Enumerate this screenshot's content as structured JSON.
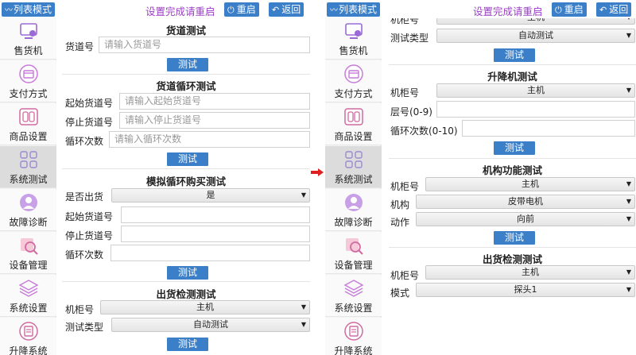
{
  "header": {
    "mode_label": "列表模式",
    "title": "设置完成请重启",
    "restart_label": "重启",
    "back_label": "返回"
  },
  "sidebar": {
    "items": [
      {
        "label": "售货机",
        "icon": "vending-machine-icon"
      },
      {
        "label": "支付方式",
        "icon": "payment-card-icon"
      },
      {
        "label": "商品设置",
        "icon": "product-icon"
      },
      {
        "label": "系统测试",
        "icon": "system-test-icon"
      },
      {
        "label": "故障诊断",
        "icon": "fault-diagnosis-icon"
      },
      {
        "label": "设备管理",
        "icon": "device-manage-icon"
      },
      {
        "label": "系统设置",
        "icon": "system-settings-icon"
      },
      {
        "label": "升降系统",
        "icon": "lift-system-icon"
      }
    ],
    "active_index": 3
  },
  "left": {
    "channel_test": {
      "title": "货道测试",
      "channel_label": "货道号",
      "channel_placeholder": "请输入货道号",
      "test_label": "测试"
    },
    "loop_test": {
      "title": "货道循环测试",
      "start_label": "起始货道号",
      "start_placeholder": "请输入起始货道号",
      "stop_label": "停止货道号",
      "stop_placeholder": "请输入停止货道号",
      "count_label": "循环次数",
      "count_placeholder": "请输入循环次数",
      "test_label": "测试"
    },
    "sim_purchase": {
      "title": "模拟循环购买测试",
      "dispense_label": "是否出货",
      "dispense_value": "是",
      "start_label": "起始货道号",
      "stop_label": "停止货道号",
      "count_label": "循环次数",
      "test_label": "测试"
    },
    "dispense_detect": {
      "title": "出货检测测试",
      "cabinet_label": "机柜号",
      "cabinet_value": "主机",
      "type_label": "测试类型",
      "type_value": "自动测试",
      "test_label": "测试"
    }
  },
  "right": {
    "dispense_detect_cont": {
      "cabinet_label": "机柜号",
      "cabinet_value": "主机",
      "type_label": "测试类型",
      "type_value": "自动测试",
      "test_label": "测试"
    },
    "lift_test": {
      "title": "升降机测试",
      "cabinet_label": "机柜号",
      "cabinet_value": "主机",
      "layer_label": "层号(0-9)",
      "loop_label": "循环次数(0-10)",
      "test_label": "测试"
    },
    "mechanism_test": {
      "title": "机构功能测试",
      "cabinet_label": "机柜号",
      "cabinet_value": "主机",
      "mech_label": "机构",
      "mech_value": "皮带电机",
      "action_label": "动作",
      "action_value": "向前",
      "test_label": "测试"
    },
    "dispense_detect2": {
      "title": "出货检测测试",
      "cabinet_label": "机柜号",
      "cabinet_value": "主机",
      "mode_label": "模式",
      "mode_value": "探头1"
    }
  },
  "colors": {
    "accent_blue": "#3b7fc8",
    "title_purple": "#9b3cc6",
    "arrow_red": "#e02020"
  }
}
